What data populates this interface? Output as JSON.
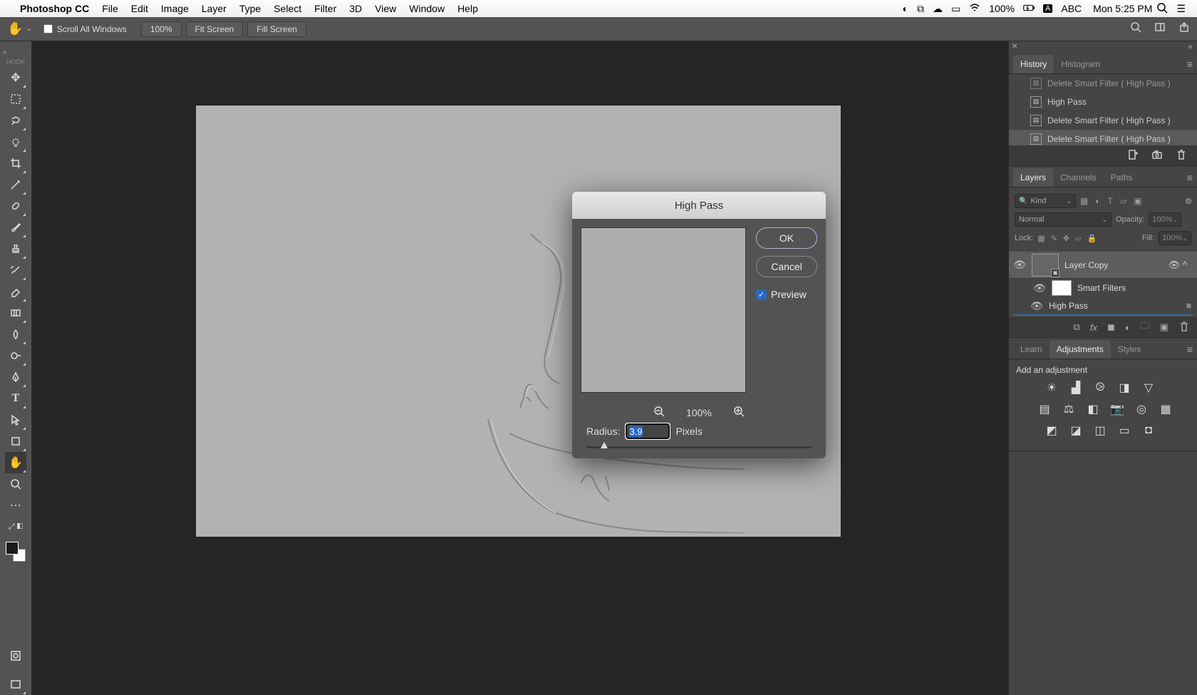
{
  "menubar": {
    "app_name": "Photoshop CC",
    "items": [
      "File",
      "Edit",
      "Image",
      "Layer",
      "Type",
      "Select",
      "Filter",
      "3D",
      "View",
      "Window",
      "Help"
    ],
    "battery_pct": "100%",
    "input_source": "ABC",
    "clock": "Mon 5:25 PM"
  },
  "optionsbar": {
    "scroll_all_label": "Scroll All Windows",
    "zoom_value": "100%",
    "fit_screen": "Fit Screen",
    "fill_screen": "Fill Screen"
  },
  "toolbox": {
    "hook_label": "HOOK"
  },
  "dialog": {
    "title": "High Pass",
    "ok": "OK",
    "cancel": "Cancel",
    "preview_label": "Preview",
    "preview_checked": true,
    "zoom_pct": "100%",
    "radius_label": "Radius:",
    "radius_value": "3.9",
    "radius_unit": "Pixels"
  },
  "history": {
    "tab_history": "History",
    "tab_histogram": "Histogram",
    "rows": [
      "Delete Smart Filter ( High Pass )",
      "High Pass",
      "Delete Smart Filter ( High Pass )",
      "Delete Smart Filter ( High Pass )"
    ]
  },
  "layers": {
    "tab_layers": "Layers",
    "tab_channels": "Channels",
    "tab_paths": "Paths",
    "kind_label": "Kind",
    "blend_mode": "Normal",
    "opacity_label": "Opacity:",
    "opacity_value": "100%",
    "lock_label": "Lock:",
    "fill_label": "Fill:",
    "fill_value": "100%",
    "layer_name": "Layer Copy",
    "smart_filters_label": "Smart Filters",
    "high_pass_label": "High Pass"
  },
  "adjustments": {
    "tab_learn": "Learn",
    "tab_adjustments": "Adjustments",
    "tab_styles": "Styles",
    "heading": "Add an adjustment"
  }
}
